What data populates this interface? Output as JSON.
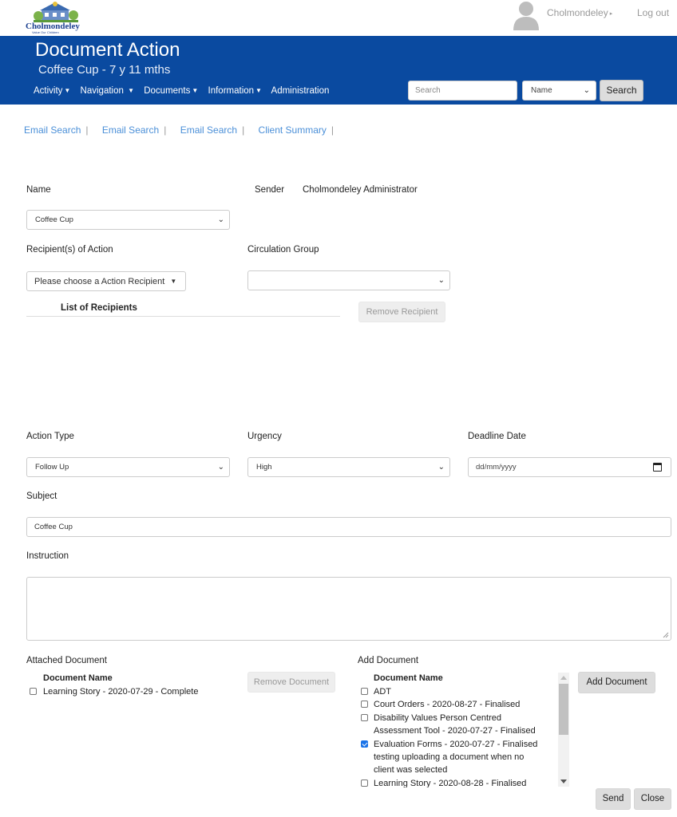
{
  "brand": {
    "logo_text": "Cholmondeley",
    "logo_tagline": "Value Our Children"
  },
  "user": {
    "name": "Cholmondeley",
    "logout_label": "Log out"
  },
  "header": {
    "title": "Document Action",
    "subtitle": "Coffee Cup - 7 y 11 mths",
    "nav": [
      "Activity",
      "Navigation",
      "Documents",
      "Information",
      "Administration"
    ],
    "search_placeholder": "Search",
    "search_type": "Name",
    "search_button": "Search"
  },
  "links": [
    "Email Search",
    "Email Search",
    "Email Search",
    "Client Summary"
  ],
  "form": {
    "name_label": "Name",
    "name_value": "Coffee Cup",
    "sender_label": "Sender",
    "sender_value": "Cholmondeley Administrator",
    "recipients_label": "Recipient(s) of Action",
    "recipient_dropdown": "Please choose a Action Recipient",
    "circulation_label": "Circulation Group",
    "circulation_value": "",
    "list_recipients_heading": "List of Recipients",
    "remove_recipient_button": "Remove Recipient",
    "action_type_label": "Action Type",
    "action_type_value": "Follow Up",
    "urgency_label": "Urgency",
    "urgency_value": "High",
    "deadline_label": "Deadline Date",
    "deadline_placeholder": "dd/mm/yyyy",
    "subject_label": "Subject",
    "subject_value": "Coffee Cup",
    "instruction_label": "Instruction",
    "instruction_value": ""
  },
  "attached": {
    "label": "Attached Document",
    "column_header": "Document Name",
    "items": [
      {
        "name": "Learning Story - 2020-07-29 - Complete",
        "checked": false
      }
    ],
    "remove_button": "Remove Document"
  },
  "add_document": {
    "label": "Add Document",
    "column_header": "Document Name",
    "items": [
      {
        "lines": [
          "ADT"
        ],
        "checked": false
      },
      {
        "lines": [
          "Court Orders - 2020-08-27 - Finalised"
        ],
        "checked": false
      },
      {
        "lines": [
          "Disability Values Person Centred",
          "Assessment Tool - 2020-07-27 - Finalised"
        ],
        "checked": false
      },
      {
        "lines": [
          "Evaluation Forms - 2020-07-27 - Finalised",
          "testing uploading a document when no",
          "client was selected"
        ],
        "checked": true
      },
      {
        "lines": [
          "Learning Story - 2020-08-28 - Finalised"
        ],
        "checked": false
      }
    ],
    "add_button": "Add Document"
  },
  "footer": {
    "send_button": "Send",
    "close_button": "Close"
  },
  "colors": {
    "header_bg": "#0a4aa0",
    "link": "#4a8fd8",
    "checkbox_checked": "#1a73e8"
  }
}
